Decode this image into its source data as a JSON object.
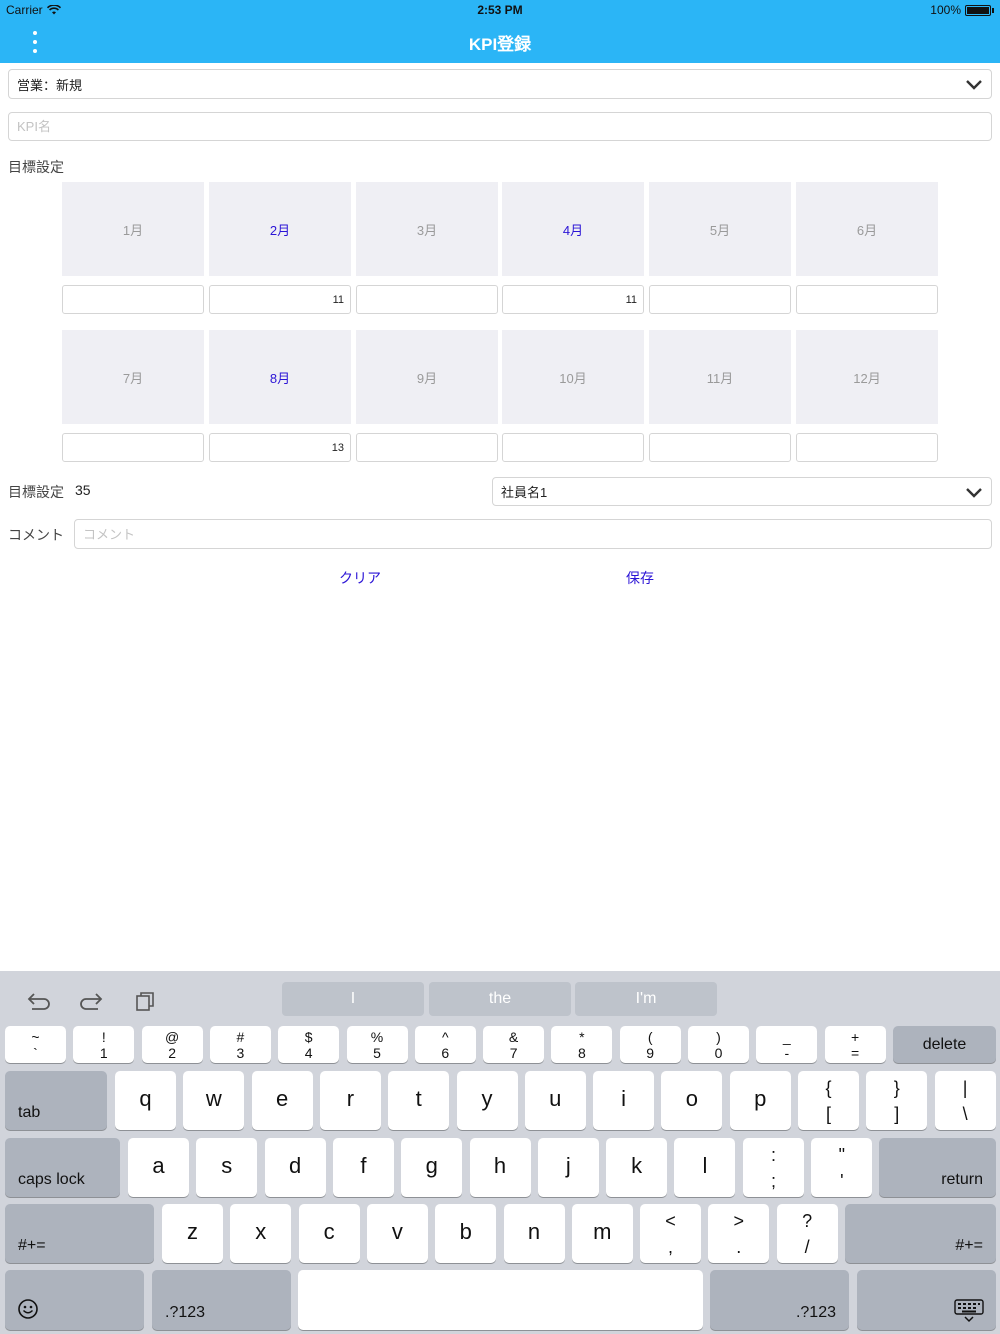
{
  "status_bar": {
    "carrier": "Carrier",
    "time": "2:53 PM",
    "battery": "100%"
  },
  "nav": {
    "title": "KPI登録"
  },
  "form": {
    "category_select": "営業：新規",
    "kpi_name_placeholder": "KPI名",
    "target_label": "目標設定",
    "months": [
      {
        "label": "1月",
        "value": "",
        "active": false
      },
      {
        "label": "2月",
        "value": "11",
        "active": true
      },
      {
        "label": "3月",
        "value": "",
        "active": false
      },
      {
        "label": "4月",
        "value": "11",
        "active": true
      },
      {
        "label": "5月",
        "value": "",
        "active": false
      },
      {
        "label": "6月",
        "value": "",
        "active": false
      },
      {
        "label": "7月",
        "value": "",
        "active": false
      },
      {
        "label": "8月",
        "value": "13",
        "active": true
      },
      {
        "label": "9月",
        "value": "",
        "active": false
      },
      {
        "label": "10月",
        "value": "",
        "active": false
      },
      {
        "label": "11月",
        "value": "",
        "active": false
      },
      {
        "label": "12月",
        "value": "",
        "active": false
      }
    ],
    "total_label": "目標設定",
    "total_value": "35",
    "employee_select": "社員名1",
    "comment_label": "コメント",
    "comment_placeholder": "コメント",
    "clear_label": "クリア",
    "save_label": "保存"
  },
  "keyboard": {
    "suggestions": [
      "I",
      "the",
      "I'm"
    ],
    "number_row": [
      {
        "top": "~",
        "bot": "`"
      },
      {
        "top": "!",
        "bot": "1"
      },
      {
        "top": "@",
        "bot": "2"
      },
      {
        "top": "#",
        "bot": "3"
      },
      {
        "top": "$",
        "bot": "4"
      },
      {
        "top": "%",
        "bot": "5"
      },
      {
        "top": "^",
        "bot": "6"
      },
      {
        "top": "&",
        "bot": "7"
      },
      {
        "top": "*",
        "bot": "8"
      },
      {
        "top": "(",
        "bot": "9"
      },
      {
        "top": ")",
        "bot": "0"
      },
      {
        "top": "_",
        "bot": "-"
      },
      {
        "top": "+",
        "bot": "="
      }
    ],
    "delete_label": "delete",
    "tab_label": "tab",
    "row_q": [
      "q",
      "w",
      "e",
      "r",
      "t",
      "y",
      "u",
      "i",
      "o",
      "p"
    ],
    "row_q_symbols": [
      {
        "top": "{",
        "bot": "["
      },
      {
        "top": "}",
        "bot": "]"
      },
      {
        "top": "|",
        "bot": "\\"
      }
    ],
    "caps_label": "caps lock",
    "row_a": [
      "a",
      "s",
      "d",
      "f",
      "g",
      "h",
      "j",
      "k",
      "l"
    ],
    "row_a_symbols": [
      {
        "top": ":",
        "bot": ";"
      },
      {
        "top": "\"",
        "bot": "'"
      }
    ],
    "return_label": "return",
    "shift_label": "#+=",
    "row_z": [
      "z",
      "x",
      "c",
      "v",
      "b",
      "n",
      "m"
    ],
    "row_z_symbols": [
      {
        "top": "<",
        "bot": ","
      },
      {
        "top": ">",
        "bot": "."
      },
      {
        "top": "?",
        "bot": "/"
      }
    ],
    "numbers_label": ".?123",
    "emoji_icon": "emoji-icon",
    "dismiss_icon": "keyboard-dismiss-icon"
  }
}
